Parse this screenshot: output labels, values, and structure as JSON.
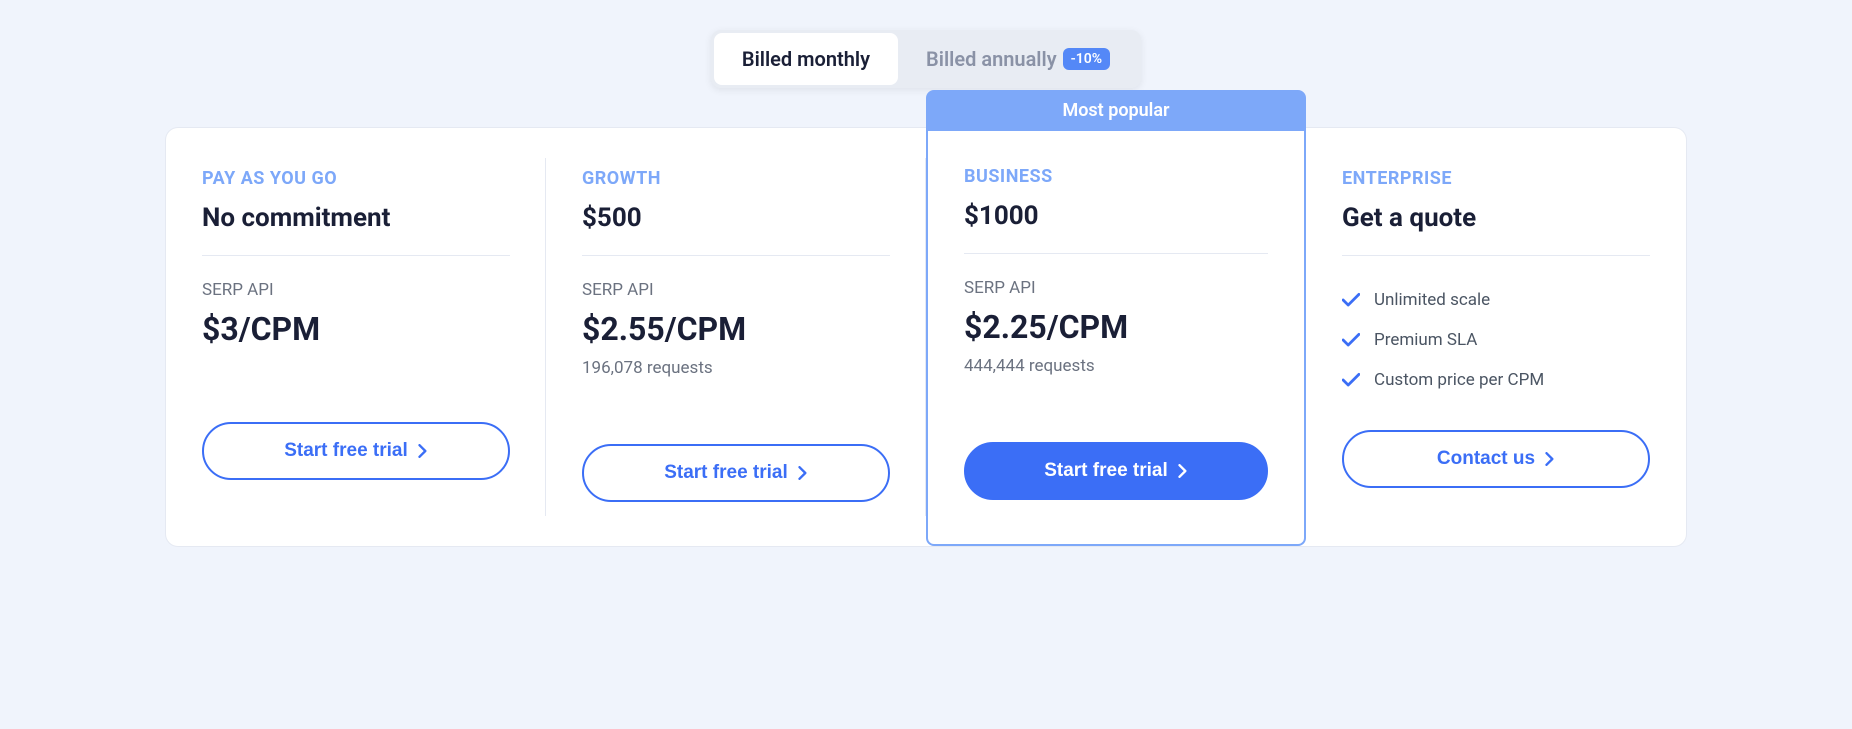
{
  "billing": {
    "monthly": "Billed monthly",
    "annually": "Billed annually",
    "discount": "-10%"
  },
  "popular_label": "Most popular",
  "plans": [
    {
      "name": "PAY AS YOU GO",
      "price": "No commitment",
      "api_label": "SERP API",
      "cpm": "$3/CPM",
      "requests": "",
      "cta": "Start free trial"
    },
    {
      "name": "GROWTH",
      "price": "$500",
      "api_label": "SERP API",
      "cpm": "$2.55/CPM",
      "requests": "196,078 requests",
      "cta": "Start free trial"
    },
    {
      "name": "BUSINESS",
      "price": "$1000",
      "api_label": "SERP API",
      "cpm": "$2.25/CPM",
      "requests": "444,444 requests",
      "cta": "Start free trial"
    },
    {
      "name": "ENTERPRISE",
      "price": "Get a quote",
      "features": [
        "Unlimited scale",
        "Premium SLA",
        "Custom price per CPM"
      ],
      "cta": "Contact us"
    }
  ]
}
